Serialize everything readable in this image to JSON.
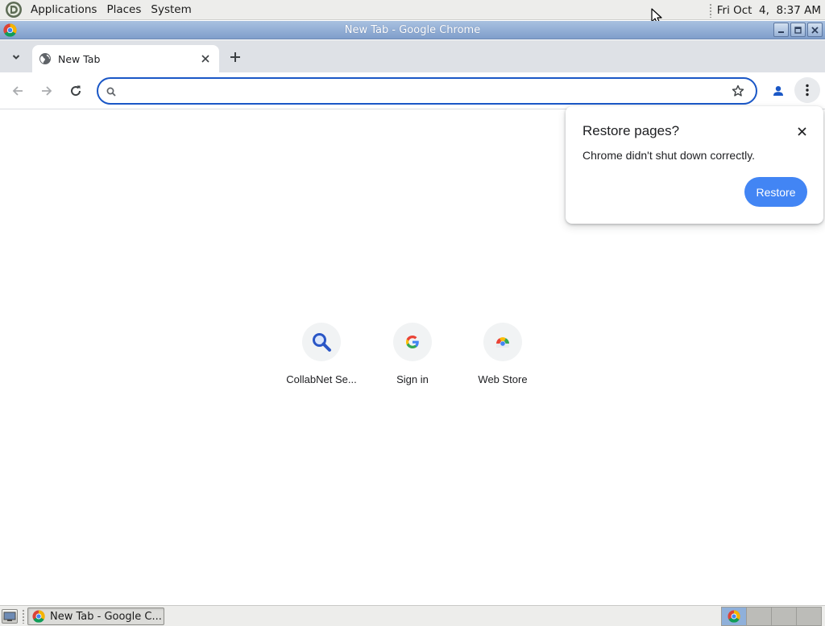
{
  "top_panel": {
    "menus": [
      "Applications",
      "Places",
      "System"
    ],
    "clock": "Fri Oct  4,  8:37 AM"
  },
  "window": {
    "title": "New Tab - Google Chrome"
  },
  "tabs": [
    {
      "title": "New Tab",
      "icon": "globe-icon"
    }
  ],
  "omnibox": {
    "value": "",
    "placeholder": ""
  },
  "shortcuts": [
    {
      "label": "CollabNet Se...",
      "icon": "magnifier-icon"
    },
    {
      "label": "Sign in",
      "icon": "google-g-icon"
    },
    {
      "label": "Web Store",
      "icon": "web-store-icon"
    }
  ],
  "restore_bubble": {
    "title": "Restore pages?",
    "message": "Chrome didn't shut down correctly.",
    "button": "Restore"
  },
  "taskbar": {
    "task_label": "New Tab - Google C..."
  },
  "colors": {
    "accent": "#1a57c6",
    "restore_button": "#4285f4",
    "titlebar": "#8fa9d2"
  }
}
